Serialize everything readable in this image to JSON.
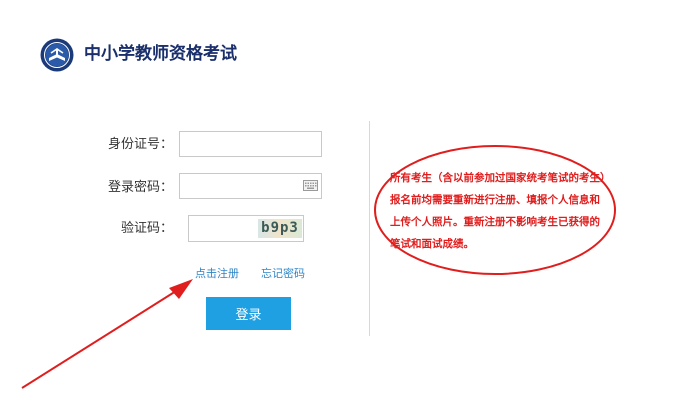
{
  "header": {
    "title": "中小学教师资格考试"
  },
  "form": {
    "id_label": "身份证号：",
    "id_value": "",
    "password_label": "登录密码：",
    "password_value": "",
    "captcha_label": "验证码：",
    "captcha_value": "",
    "captcha_code": "b9p3",
    "register_link": "点击注册",
    "forgot_link": "忘记密码",
    "login_button": "登录"
  },
  "notice": {
    "text": "所有考生（含以前参加过国家统考笔试的考生）报名前均需要重新进行注册、填报个人信息和上传个人照片。重新注册不影响考生已获得的笔试和面试成绩。"
  },
  "colors": {
    "brand": "#1a2f6b",
    "button": "#1ea0e2",
    "link": "#2f86c6",
    "annotation": "#e01e1e"
  },
  "icons": [
    "logo-emblem-icon",
    "keyboard-icon"
  ]
}
